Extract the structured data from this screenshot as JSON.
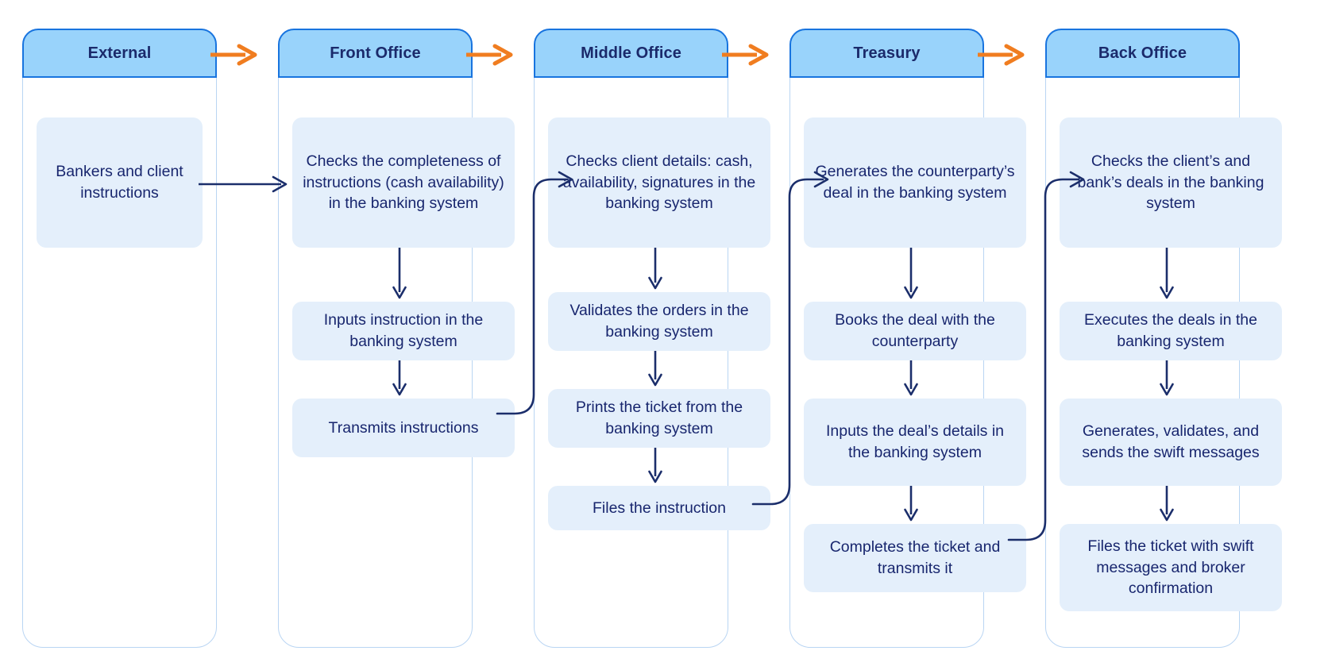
{
  "diagram": {
    "title": "Banking operations process flow",
    "colors": {
      "lane_header_fill": "#99d3fb",
      "lane_header_border": "#1874df",
      "lane_body_border": "#b9d5f3",
      "step_fill": "#e4effb",
      "text_navy": "#18266e",
      "connector_navy": "#1b2e6b",
      "header_arrow_orange": "#f07d20"
    },
    "lanes": [
      {
        "id": "external",
        "title": "External",
        "steps": [
          {
            "id": "bankers-and-client-instructions",
            "label": "Bankers and client instructions"
          }
        ]
      },
      {
        "id": "front-office",
        "title": "Front Office",
        "steps": [
          {
            "id": "checks-completeness",
            "label": "Checks the completeness of instructions (cash availability) in the banking system"
          },
          {
            "id": "inputs-instruction",
            "label": "Inputs instruction in the banking system"
          },
          {
            "id": "transmits-instructions",
            "label": "Transmits instructions"
          }
        ]
      },
      {
        "id": "middle-office",
        "title": "Middle Office",
        "steps": [
          {
            "id": "checks-client-details",
            "label": "Checks client details: cash, availability, signatures in the banking system"
          },
          {
            "id": "validates-the-orders",
            "label": "Validates the orders in the banking system"
          },
          {
            "id": "prints-the-ticket",
            "label": "Prints the ticket from the banking system"
          },
          {
            "id": "files-the-instruction",
            "label": "Files the instruction"
          }
        ]
      },
      {
        "id": "treasury",
        "title": "Treasury",
        "steps": [
          {
            "id": "generates-counterparty-deal",
            "label": "Generates the counterparty’s deal in the banking system"
          },
          {
            "id": "books-the-deal",
            "label": "Books the deal with the counterparty"
          },
          {
            "id": "inputs-deal-details",
            "label": "Inputs the deal’s details in the banking system"
          },
          {
            "id": "completes-the-ticket",
            "label": "Completes the ticket and transmits it"
          }
        ]
      },
      {
        "id": "back-office",
        "title": "Back Office",
        "steps": [
          {
            "id": "checks-client-and-bank-deals",
            "label": "Checks the client’s and bank’s deals in the banking system"
          },
          {
            "id": "executes-the-deals",
            "label": "Executes the deals in the banking system"
          },
          {
            "id": "generates-validates-sends-swift",
            "label": "Generates, validates, and sends the swift messages"
          },
          {
            "id": "files-the-ticket",
            "label": "Files the ticket with swift messages and broker confirmation"
          }
        ]
      }
    ],
    "lane_arrows": [
      {
        "id": "external-to-front-office",
        "from": "External",
        "to": "Front Office"
      },
      {
        "id": "front-office-to-middle-office",
        "from": "Front Office",
        "to": "Middle Office"
      },
      {
        "id": "middle-office-to-treasury",
        "from": "Middle Office",
        "to": "Treasury"
      },
      {
        "id": "treasury-to-back-office",
        "from": "Treasury",
        "to": "Back Office"
      }
    ],
    "cross_lane_connectors": [
      {
        "id": "bankers-to-checks-completeness",
        "from": "Bankers and client instructions",
        "to": "Checks the completeness of instructions (cash availability) in the banking system"
      },
      {
        "id": "transmits-to-checks-client-details",
        "from": "Transmits instructions",
        "to": "Checks client details: cash, availability, signatures in the banking system"
      },
      {
        "id": "files-instruction-to-generates-deal",
        "from": "Files the instruction",
        "to": "Generates the counterparty’s deal in the banking system"
      },
      {
        "id": "completes-ticket-to-checks-deals",
        "from": "Completes the ticket and transmits it",
        "to": "Checks the client’s and bank’s deals in the banking system"
      }
    ]
  }
}
